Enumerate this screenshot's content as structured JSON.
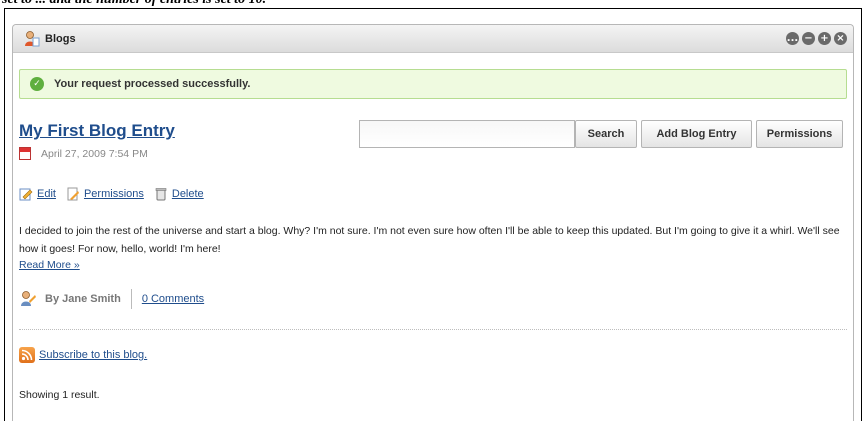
{
  "caption_fragment": "set to ... and the number of entries is set to 10.",
  "portlet": {
    "title": "Blogs",
    "controls": [
      "...",
      "−",
      "+",
      "×"
    ]
  },
  "message": {
    "success": "Your request processed successfully."
  },
  "toolbar": {
    "search_value": "",
    "search_label": "Search",
    "add_label": "Add Blog Entry",
    "permissions_label": "Permissions"
  },
  "entry": {
    "title": "My First Blog Entry",
    "date": "April 27, 2009 7:54 PM",
    "actions": {
      "edit": "Edit",
      "permissions": "Permissions",
      "delete": "Delete"
    },
    "body": "I decided to join the rest of the universe and start a blog. Why? I'm not sure. I'm not even sure how often I'll be able to keep this updated. But I'm going to give it a whirl. We'll see how it goes! For now, hello, world! I'm here!",
    "read_more": "Read More »",
    "author": "By Jane Smith",
    "comments": "0 Comments"
  },
  "subscribe": "Subscribe to this blog.",
  "results": "Showing 1 result."
}
